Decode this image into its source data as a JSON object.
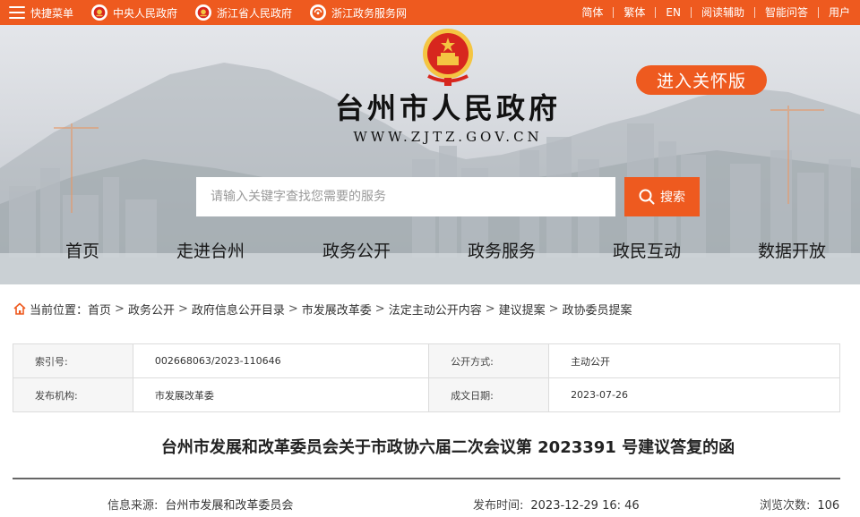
{
  "topbar": {
    "quick_menu": "快捷菜单",
    "links_left": [
      "中央人民政府",
      "浙江省人民政府",
      "浙江政务服务网"
    ],
    "links_right": [
      "简体",
      "繁体",
      "EN",
      "阅读辅助",
      "智能问答",
      "用户"
    ]
  },
  "header": {
    "site_title": "台州市人民政府",
    "site_url": "WWW.ZJTZ.GOV.CN",
    "care_version": "进入关怀版"
  },
  "search": {
    "placeholder": "请输入关键字查找您需要的服务",
    "button": "搜索"
  },
  "nav": [
    "首页",
    "走进台州",
    "政务公开",
    "政务服务",
    "政民互动",
    "数据开放"
  ],
  "breadcrumb": {
    "prefix": "当前位置：",
    "items": [
      "首页",
      "政务公开",
      "政府信息公开目录",
      "市发展改革委",
      "法定主动公开内容",
      "建议提案",
      "政协委员提案"
    ],
    "separator": ">"
  },
  "info": {
    "index_label": "索引号:",
    "index_value": "002668063/2023-110646",
    "disclosure_label": "公开方式:",
    "disclosure_value": "主动公开",
    "publisher_label": "发布机构:",
    "publisher_value": "市发展改革委",
    "date_label": "成文日期:",
    "date_value": "2023-07-26"
  },
  "article": {
    "title": "台州市发展和改革委员会关于市政协六届二次会议第 2023391 号建议答复的函",
    "source_label": "信息来源:",
    "source_value": "台州市发展和改革委员会",
    "publish_label": "发布时间:",
    "publish_value": "2023-12-29 16: 46",
    "views_label": "浏览次数:",
    "views_value": "106"
  },
  "colors": {
    "accent": "#ee5a1f",
    "emblem_red": "#d7261e",
    "emblem_gold": "#f4c542"
  },
  "icons": [
    "menu-icon",
    "national-emblem-icon",
    "search-icon",
    "home-icon"
  ]
}
